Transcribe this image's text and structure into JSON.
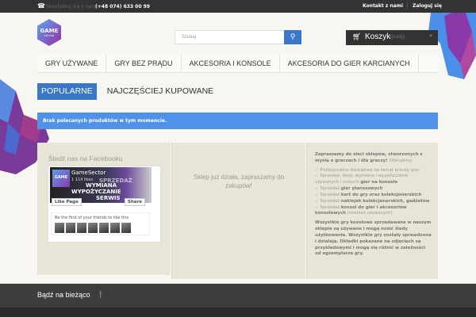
{
  "topbar": {
    "contact_label": "Skontaktuj się z nami:",
    "phone": "(+48 074) 633 00 99",
    "contact_link": "Kontakt z nami",
    "login_link": "Zaloguj się"
  },
  "logo": {
    "line1": "GAME",
    "line2": "SECTOR"
  },
  "search": {
    "placeholder": "Szukaj",
    "button_icon": "search-icon"
  },
  "cart": {
    "label": "Koszyk",
    "status": "(pusty)"
  },
  "nav": [
    "GRY UŻYWANE",
    "GRY BEZ PRĄDU",
    "AKCESORIA I KONSOLE",
    "AKCESORIA DO GIER KARCIANYCH"
  ],
  "tabs": [
    "POPULARNE",
    "NAJCZĘŚCIEJ KUPOWANE"
  ],
  "alert": "Brak polecanych produktów w tym momencie.",
  "facebook": {
    "title": "Śledź nas na Facebooku",
    "page_name": "GameSector",
    "likes": "1 114 likes",
    "cover_words": [
      "SPRZEDAŻ",
      "WYMIANA",
      "WYPOŻYCZANIE",
      "SERWIS"
    ],
    "like_btn": "Like Page",
    "share_btn": "Share",
    "friends_text": "Be the first of your friends to like this"
  },
  "promo": "Sklep już działa, zapraszamy do zakupów!",
  "about": {
    "intro_bold": "Zapraszamy do sieci sklepów, stworzonych z myślą o graczach i dla graczy!",
    "intro_rest": " Oferujemy:",
    "items": [
      {
        "pre": "Profesjonalne doradztwo na temat branży gier.",
        "bold": "",
        "post": ""
      },
      {
        "pre": "Sprzedaż, skup, wymianę i wypożyczanie używanych i nowych ",
        "bold": "gier na konsole",
        "post": ""
      },
      {
        "pre": "Sprzedaż ",
        "bold": "gier planszowych",
        "post": ""
      },
      {
        "pre": "Sprzedaż ",
        "bold": "kart do gry oraz kolekcjonerskich",
        "post": ""
      },
      {
        "pre": "Sprzedaż ",
        "bold": "naklejek kolekcjonerskich, gadżetów",
        "post": ""
      },
      {
        "pre": "Sprzedaż ",
        "bold": "konsol do gier i akcesoriów konsolowych",
        "post": " (również używanych)"
      }
    ],
    "outro": "Wszystkie gry kosolowe sprzedawane w naszym sklepie są używane i mogą nosić ślady użytkowania. Wszystkie gry zostały sprawdzone i działają. Okładki pokazane na zdjęciach są przykładowymi i mogą się różnić w zależności od egzemplarza gry."
  },
  "footer": {
    "title": "Bądź na bieżąco",
    "social_icon": "facebook-icon"
  },
  "colors": {
    "accent": "#3a77c6",
    "alert": "#5092e8",
    "dark": "#333333"
  }
}
